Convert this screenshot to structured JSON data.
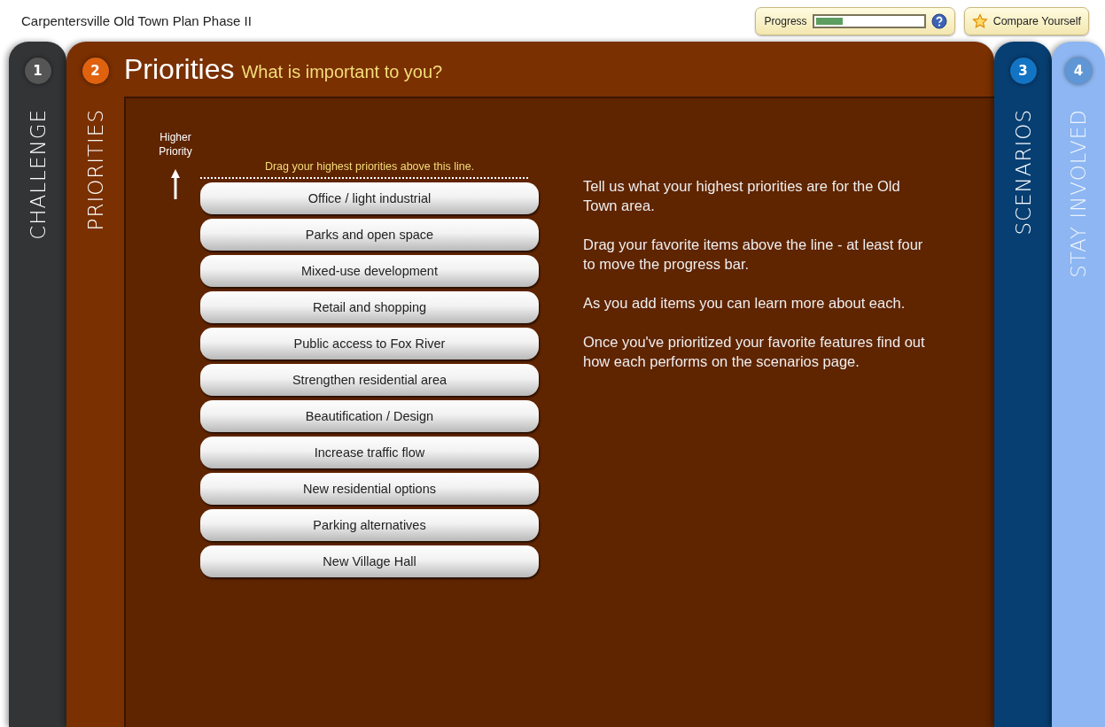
{
  "window": {
    "title": "Carpentersville Old Town Plan Phase II"
  },
  "progress": {
    "label": "Progress",
    "level": 0.25
  },
  "compare_button": {
    "label": "Compare Yourself"
  },
  "steps": [
    {
      "number": "1",
      "label": "CHALLENGE",
      "selected": false,
      "color": "#333436"
    },
    {
      "number": "2",
      "label": "PRIORITIES",
      "selected": true,
      "color": "#7a3000",
      "title": "Priorities",
      "subtitle": "What is important to you?"
    },
    {
      "number": "3",
      "label": "SCENARIOS",
      "selected": false,
      "color": "#073f72"
    },
    {
      "number": "4",
      "label": "STAY INVOLVED",
      "selected": false,
      "color": "#8db6f2"
    }
  ],
  "ranking": {
    "axis_label": "Higher Priority",
    "line_hint": "Drag your highest priorities above this line.",
    "items": [
      "Office / light industrial",
      "Parks and open space",
      "Mixed-use development",
      "Retail and shopping",
      "Public access to Fox River",
      "Strengthen residential area",
      "Beautification / Design",
      "Increase traffic flow",
      "New residential options",
      "Parking alternatives",
      "New Village Hall"
    ]
  },
  "instructions": [
    "Tell us what your highest priorities are for the Old Town area.",
    "Drag your favorite items above the line - at least four to move the progress bar.",
    "As you add items you can learn more about each.",
    "Once you've prioritized your favorite features find out how each performs on the scenarios page."
  ]
}
